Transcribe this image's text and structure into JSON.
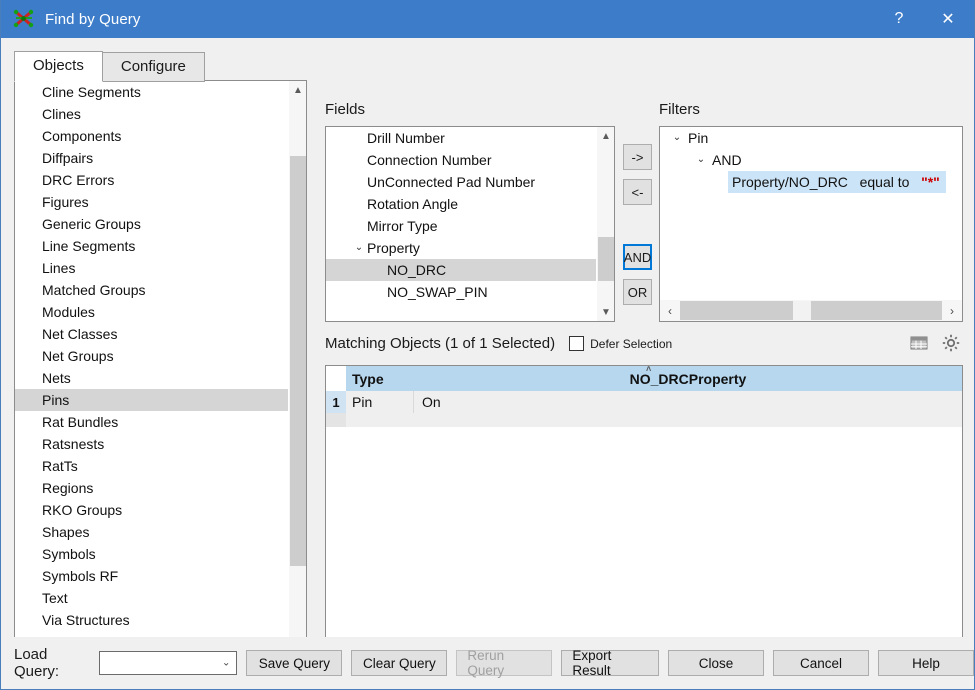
{
  "window": {
    "title": "Find by Query",
    "icon": "find-by-query-icon",
    "help_glyph": "?",
    "close_glyph": "✕"
  },
  "tabs": [
    {
      "label": "Objects",
      "active": true
    },
    {
      "label": "Configure",
      "active": false
    }
  ],
  "objects_list": {
    "selected": "Pins",
    "items": [
      "Cline Segments",
      "Clines",
      "Components",
      "Diffpairs",
      "DRC Errors",
      "Figures",
      "Generic Groups",
      "Line Segments",
      "Lines",
      "Matched Groups",
      "Modules",
      "Net Classes",
      "Net Groups",
      "Nets",
      "Pins",
      "Rat Bundles",
      "Ratsnests",
      "RatTs",
      "Regions",
      "RKO Groups",
      "Shapes",
      "Symbols",
      "Symbols RF",
      "Text",
      "Via Structures"
    ]
  },
  "fields": {
    "label": "Fields",
    "selected": "NO_DRC",
    "items": [
      {
        "label": "Drill Number",
        "level": 0,
        "caret": ""
      },
      {
        "label": "Connection Number",
        "level": 0,
        "caret": ""
      },
      {
        "label": "UnConnected Pad Number",
        "level": 0,
        "caret": ""
      },
      {
        "label": "Rotation Angle",
        "level": 0,
        "caret": ""
      },
      {
        "label": "Mirror Type",
        "level": 0,
        "caret": ""
      },
      {
        "label": "Property",
        "level": 0,
        "caret": "⌄"
      },
      {
        "label": "NO_DRC",
        "level": 1,
        "caret": ""
      },
      {
        "label": "NO_SWAP_PIN",
        "level": 1,
        "caret": ""
      }
    ]
  },
  "transfer_buttons": {
    "add": "->",
    "remove": "<-",
    "and": "AND",
    "or": "OR",
    "focused": "AND"
  },
  "filters": {
    "label": "Filters",
    "items": [
      {
        "label": "Pin",
        "level": 0,
        "caret": "⌄",
        "selected": false
      },
      {
        "label": "AND",
        "level": 1,
        "caret": "⌄",
        "selected": false
      }
    ],
    "condition": {
      "field": "Property/NO_DRC",
      "operator": "equal to",
      "value": "\"*\"",
      "selected": true
    },
    "scroll_left_glyph": "‹",
    "scroll_right_glyph": "›"
  },
  "matching": {
    "title": "Matching Objects (1 of 1 Selected)",
    "defer_label": "Defer Selection",
    "defer_checked": false,
    "grid_icon": "table-grid-icon",
    "settings_icon": "gear-icon",
    "columns": [
      "Type",
      "NO_DRCProperty"
    ],
    "sort_indicator": "˄",
    "rows": [
      {
        "num": "1",
        "type": "Pin",
        "value": "On"
      }
    ]
  },
  "footer": {
    "load_query_label": "Load Query:",
    "load_query_value": "",
    "buttons": [
      {
        "label": "Save Query",
        "disabled": false
      },
      {
        "label": "Clear Query",
        "disabled": false
      },
      {
        "label": "Rerun Query",
        "disabled": true
      },
      {
        "label": "Export Result",
        "disabled": false
      },
      {
        "label": "Close",
        "disabled": false
      },
      {
        "label": "Cancel",
        "disabled": false
      },
      {
        "label": "Help",
        "disabled": false
      }
    ],
    "combo_arrow": "⌄"
  },
  "colors": {
    "titlebar": "#3d7cc9",
    "accent_focus": "#0078d7",
    "header_blue": "#b6d7ee",
    "selection_blue": "#cce4f7",
    "selection_gray": "#d5d5d5",
    "value_red": "#cc0000",
    "dialog_bg": "#f0f0f0"
  }
}
